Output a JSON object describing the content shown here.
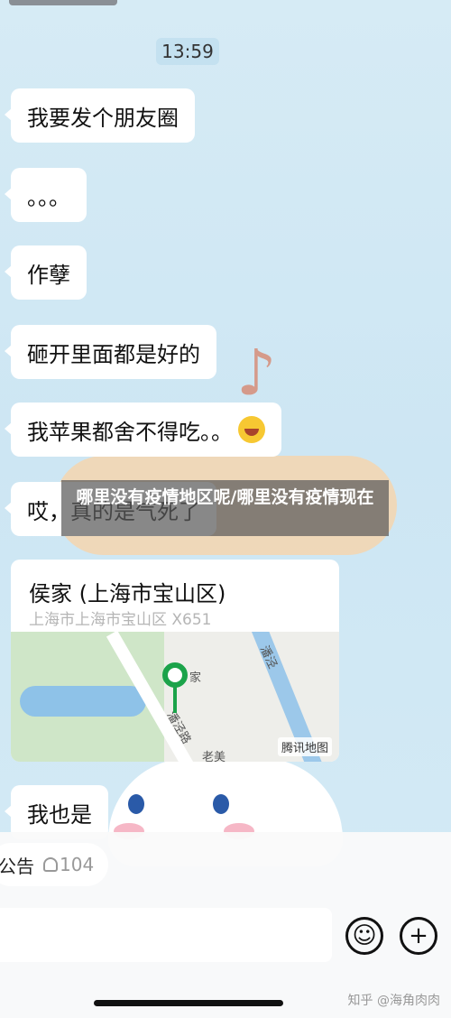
{
  "chat": {
    "timestamp": "13:59",
    "messages": [
      {
        "text": "我要发个朋友圈"
      },
      {
        "text": "。。。"
      },
      {
        "text": "作孽"
      },
      {
        "text": "砸开里面都是好的"
      },
      {
        "text": "我苹果都舍不得吃。。"
      },
      {
        "text": "哎，真的是气死了"
      },
      {
        "text": "我也是"
      }
    ],
    "location": {
      "title": "侯家 (上海市宝山区)",
      "address": "上海市上海市宝山区 X651",
      "map_labels": {
        "place": "家",
        "road": "潘泾路",
        "river": "潘泾",
        "bottom": "老美"
      },
      "map_provider": "腾讯地图"
    }
  },
  "overlay": {
    "banner_text": "哪里没有疫情地区呢/哪里没有疫情现在"
  },
  "bottom": {
    "notice_label": "公告",
    "notice_count": "104",
    "input_placeholder": ""
  },
  "watermark": {
    "text": "知乎 @海角肉肉"
  },
  "colors": {
    "background": "#cfe6f2",
    "bubble": "#ffffff",
    "pin": "#1ba34a"
  },
  "icons": {
    "emoji": "grinning-face-icon",
    "plus": "plus-icon",
    "person": "person-icon",
    "pin": "map-pin-icon"
  }
}
